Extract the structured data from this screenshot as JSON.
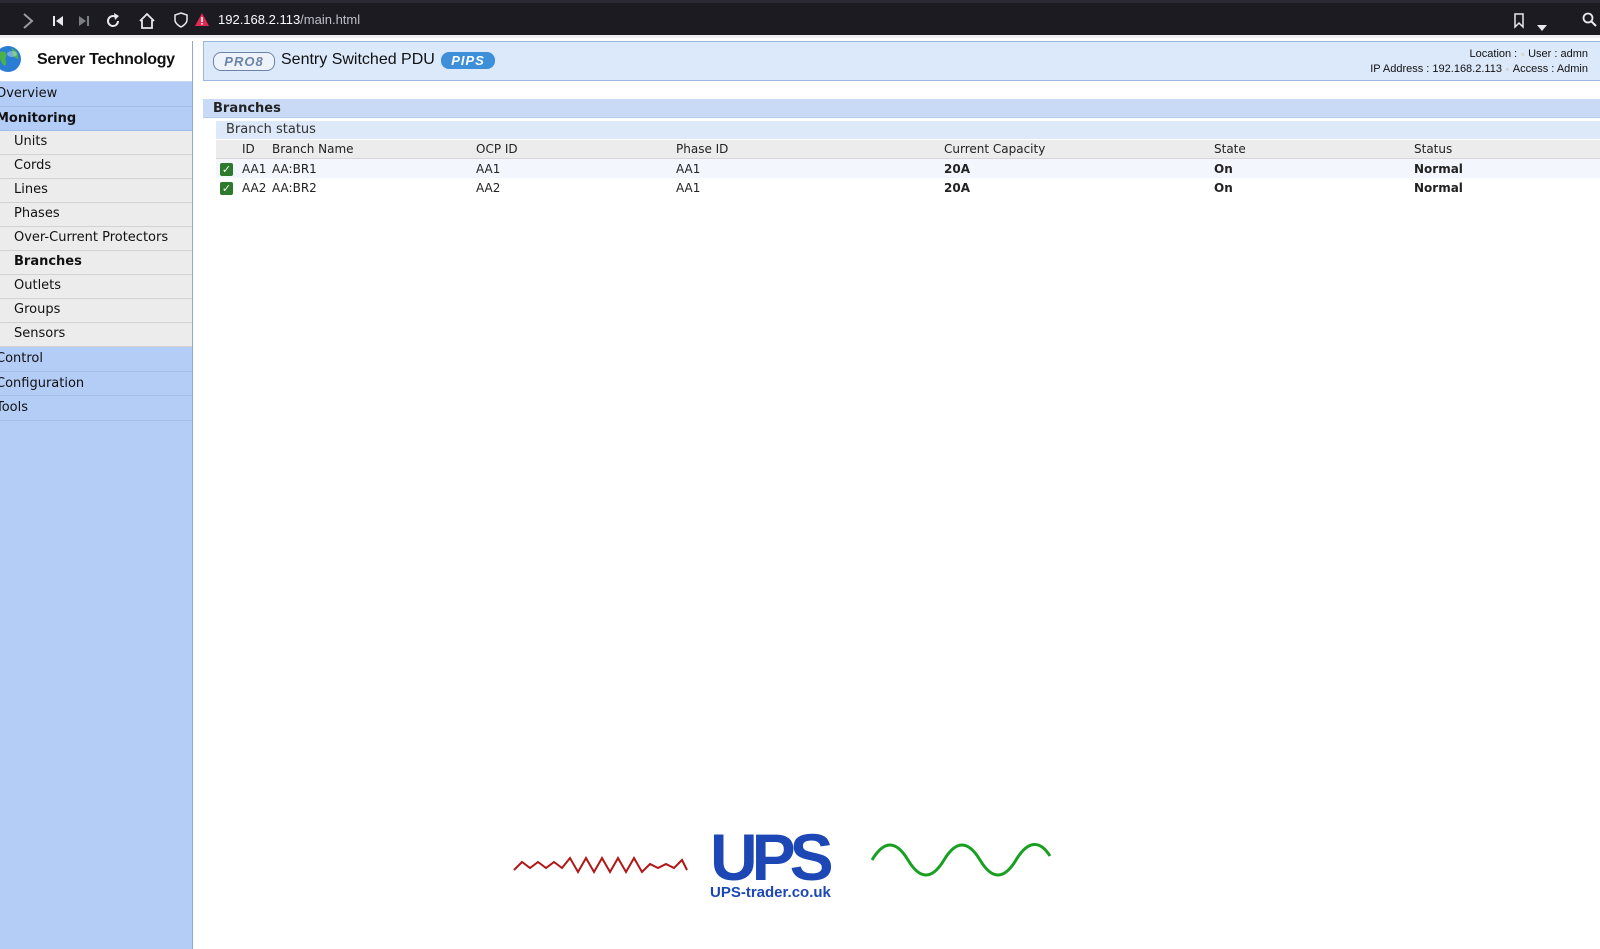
{
  "browser": {
    "url_host": "192.168.2.113",
    "url_path": "/main.html"
  },
  "brand": {
    "name": "Server Technology"
  },
  "header": {
    "badge_left": "PRO8",
    "product": "Sentry Switched PDU",
    "badge_right": "PIPS",
    "location_label": "Location :",
    "user": "User : admn",
    "ip": "IP Address : 192.168.2.113",
    "access": "Access : Admin"
  },
  "sidebar": {
    "overview": "Overview",
    "monitoring": "Monitoring",
    "monitoring_items": [
      "Units",
      "Cords",
      "Lines",
      "Phases",
      "Over-Current Protectors",
      "Branches",
      "Outlets",
      "Groups",
      "Sensors"
    ],
    "control": "Control",
    "configuration": "Configuration",
    "tools": "Tools"
  },
  "page": {
    "section_title": "Branches",
    "panel_title": "Branch status"
  },
  "table": {
    "headers": [
      "ID",
      "Branch Name",
      "OCP ID",
      "Phase ID",
      "Current Capacity",
      "State",
      "Status"
    ],
    "rows": [
      {
        "id": "AA1",
        "name": "AA:BR1",
        "ocp": "AA1",
        "phase": "AA1",
        "capacity": "20A",
        "state": "On",
        "status": "Normal"
      },
      {
        "id": "AA2",
        "name": "AA:BR2",
        "ocp": "AA2",
        "phase": "AA1",
        "capacity": "20A",
        "state": "On",
        "status": "Normal"
      }
    ]
  },
  "watermark": {
    "logo_text": "UPS",
    "caption": "UPS-trader.co.uk"
  },
  "colors": {
    "sidebar_bg": "#b3cdf7",
    "header_bg": "#dce9fb",
    "status_ok": "#2d8f1f",
    "link": "#1a1aa6"
  }
}
